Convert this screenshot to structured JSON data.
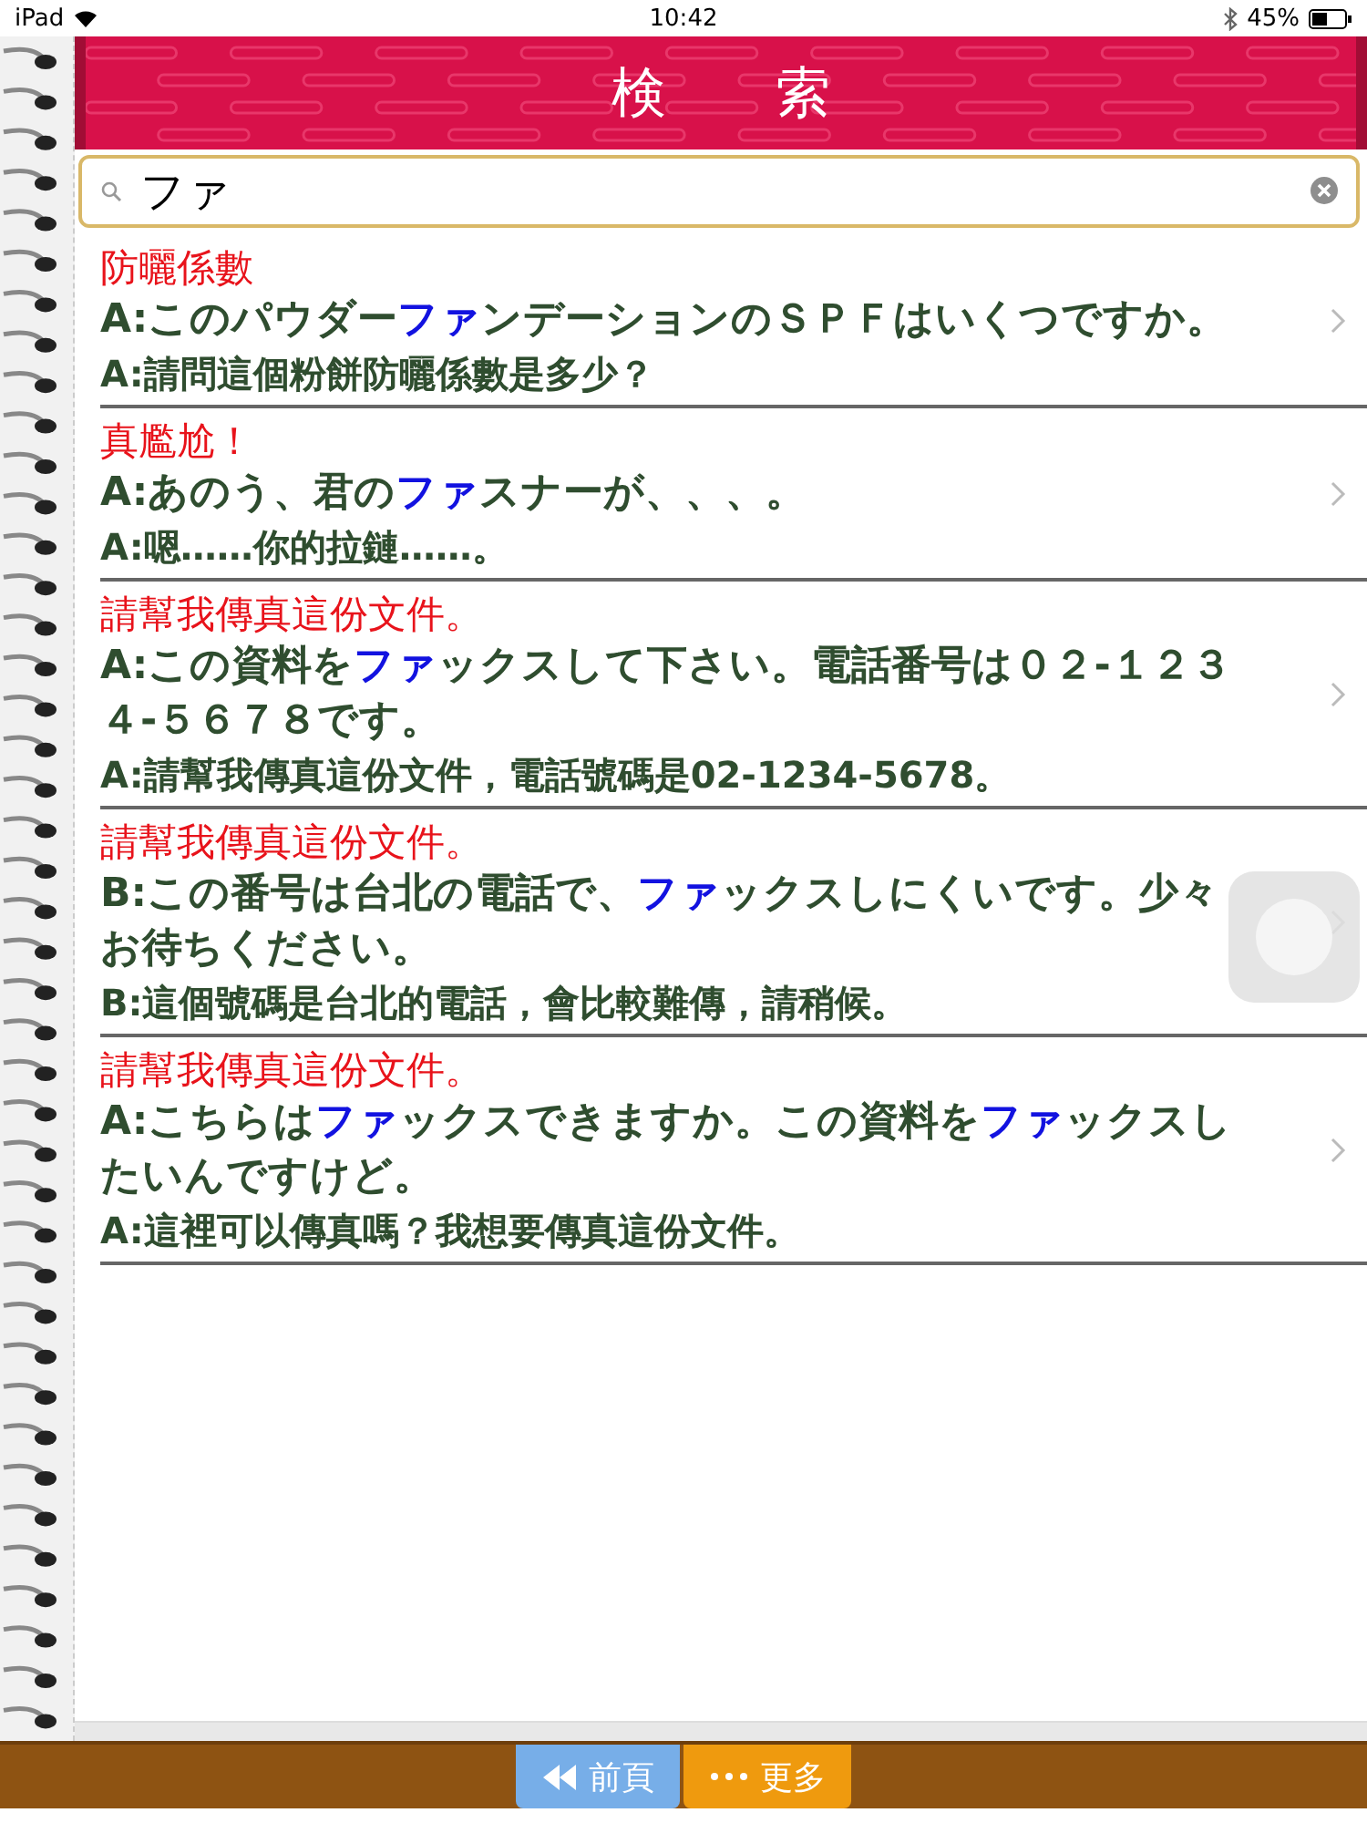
{
  "status_bar": {
    "device": "iPad",
    "time": "10:42",
    "battery": "45%"
  },
  "header": {
    "title": "検　　索"
  },
  "search": {
    "value": "ファ"
  },
  "results": [
    {
      "title": "防曬係數",
      "lines": [
        [
          {
            "text": "A:このパウダー",
            "highlight": false
          },
          {
            "text": "ファ",
            "highlight": true
          },
          {
            "text": "ンデーションのＳＰＦはいくつですか。",
            "highlight": false
          }
        ],
        [
          {
            "text": "A:請問這個粉餅防曬係數是多少？",
            "highlight": false
          }
        ]
      ]
    },
    {
      "title": "真尷尬！",
      "lines": [
        [
          {
            "text": "A:あのう、君の",
            "highlight": false
          },
          {
            "text": "ファ",
            "highlight": true
          },
          {
            "text": "スナーが、、、。",
            "highlight": false
          }
        ],
        [
          {
            "text": "A:嗯……你的拉鏈……。",
            "highlight": false
          }
        ]
      ]
    },
    {
      "title": "請幫我傳真這份文件。",
      "lines": [
        [
          {
            "text": "A:この資料を",
            "highlight": false
          },
          {
            "text": "ファ",
            "highlight": true
          },
          {
            "text": "ックスして下さい。電話番号は０２-１２３４-５６７８です。",
            "highlight": false
          }
        ],
        [
          {
            "text": "A:請幫我傳真這份文件，電話號碼是02-1234-5678。",
            "highlight": false
          }
        ]
      ]
    },
    {
      "title": "請幫我傳真這份文件。",
      "lines": [
        [
          {
            "text": "B:この番号は台北の電話で、",
            "highlight": false
          },
          {
            "text": "ファ",
            "highlight": true
          },
          {
            "text": "ックスしにくいです。少々お待ちください。",
            "highlight": false
          }
        ],
        [
          {
            "text": "B:這個號碼是台北的電話，會比較難傳，請稍候。",
            "highlight": false
          }
        ]
      ]
    },
    {
      "title": "請幫我傳真這份文件。",
      "lines": [
        [
          {
            "text": "A:こちらは",
            "highlight": false
          },
          {
            "text": "ファ",
            "highlight": true
          },
          {
            "text": "ックスできますか。この資料を",
            "highlight": false
          },
          {
            "text": "ファ",
            "highlight": true
          },
          {
            "text": "ックスしたいんですけど。",
            "highlight": false
          }
        ],
        [
          {
            "text": "A:這裡可以傳真嗎？我想要傳真這份文件。",
            "highlight": false
          }
        ]
      ]
    }
  ],
  "toolbar": [
    {
      "kind": "back",
      "label": "前頁"
    },
    {
      "kind": "more",
      "label": "更多"
    }
  ]
}
